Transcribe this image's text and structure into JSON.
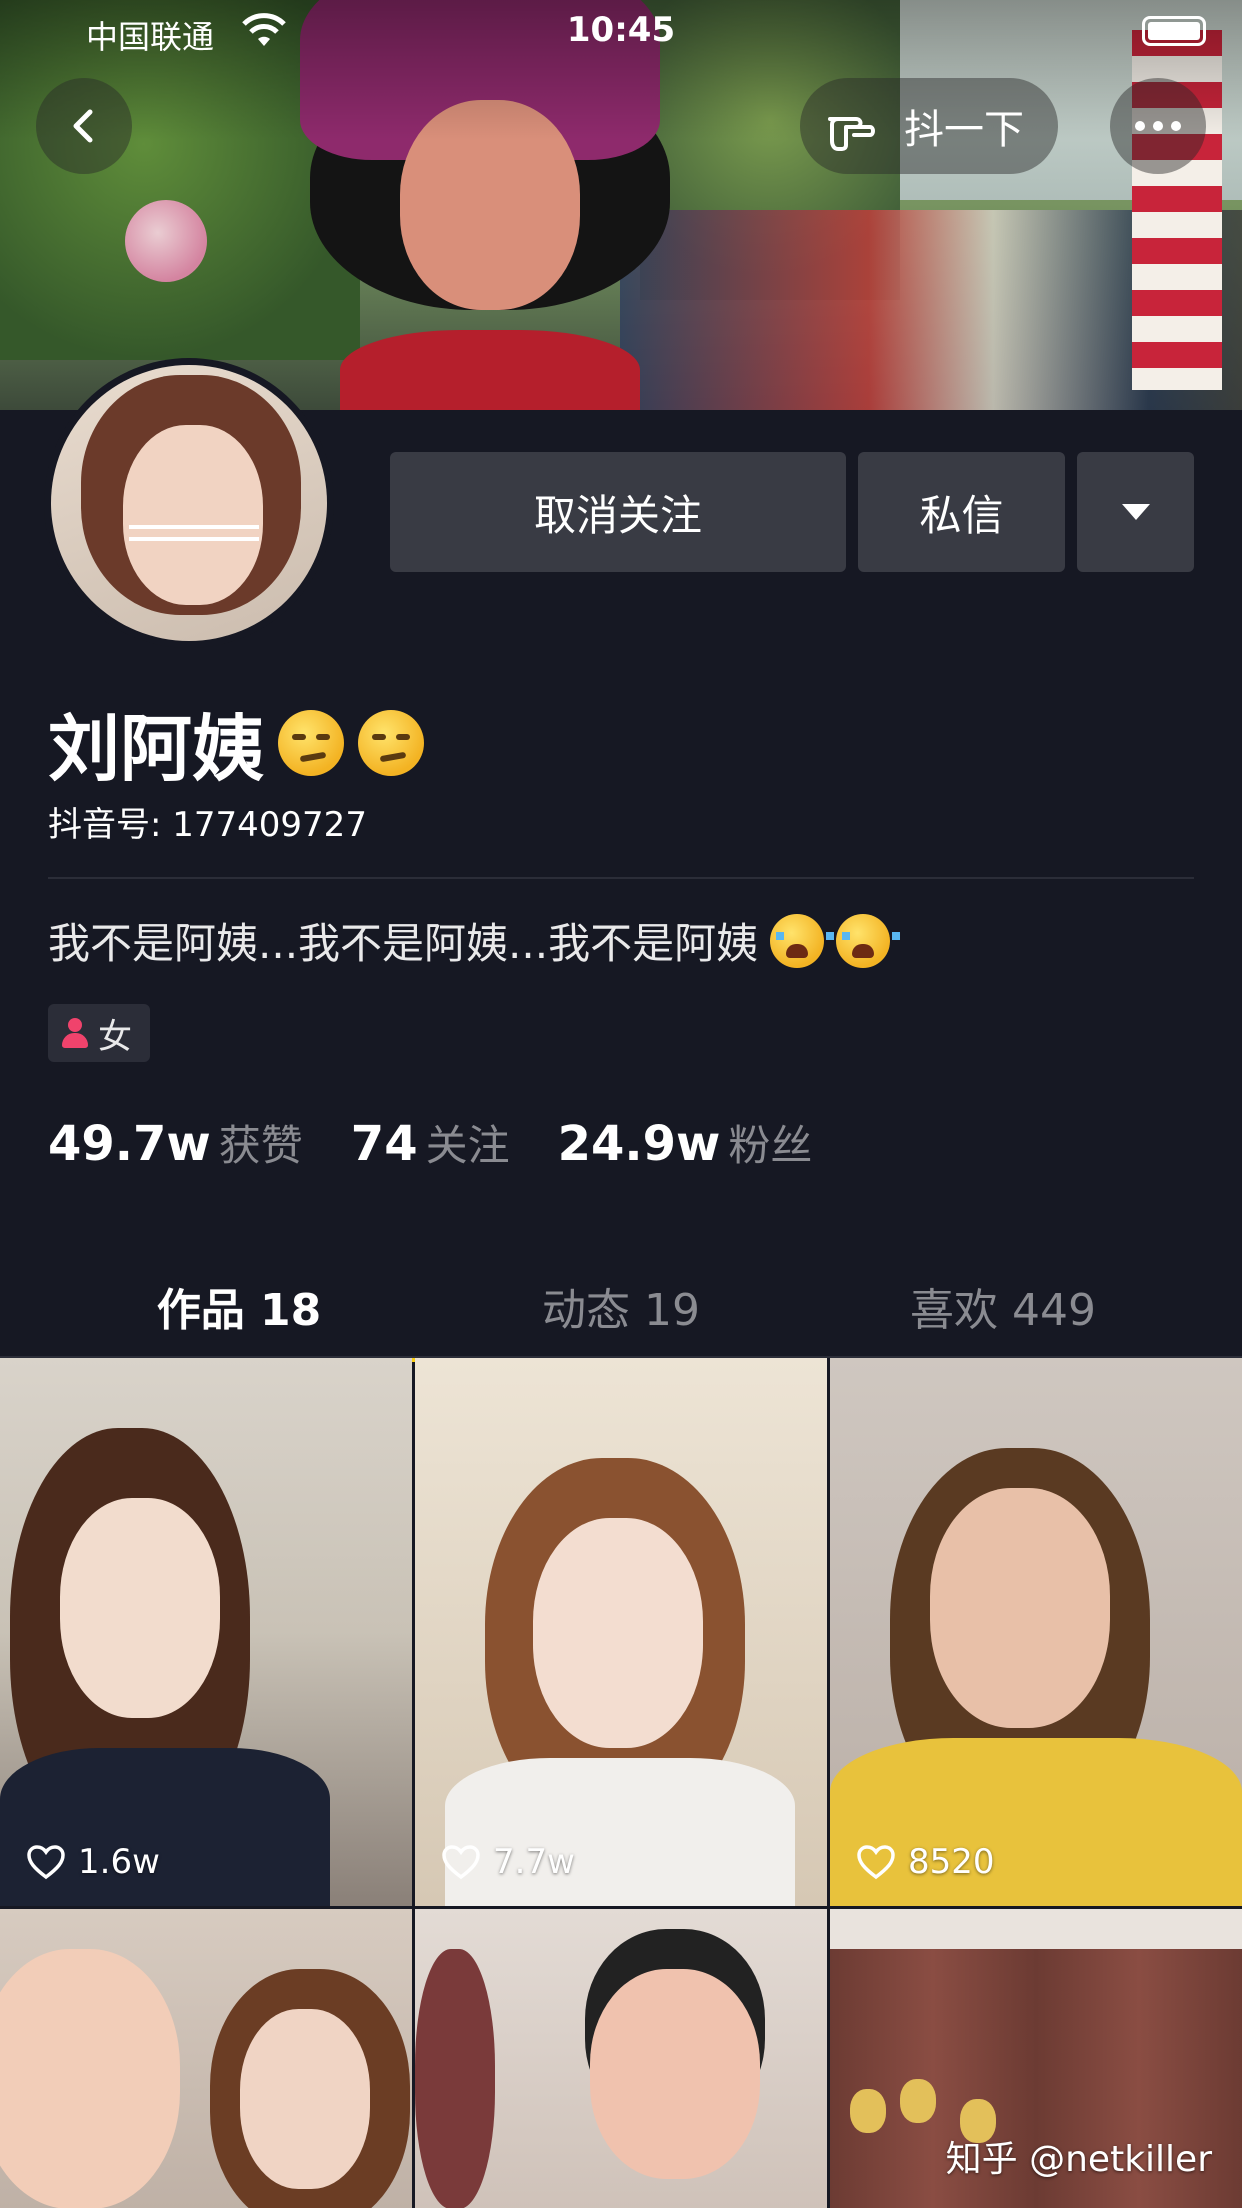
{
  "status_bar": {
    "carrier": "中国联通",
    "time": "10:45"
  },
  "top_controls": {
    "doudou_label": "抖一下"
  },
  "profile": {
    "name": "刘阿姨",
    "douyin_id": "抖音号: 177409727",
    "bio": "我不是阿姨...我不是阿姨...我不是阿姨",
    "gender": "女",
    "stats": [
      {
        "value": "49.7w",
        "label": "获赞"
      },
      {
        "value": "74",
        "label": "关注"
      },
      {
        "value": "24.9w",
        "label": "粉丝"
      }
    ]
  },
  "actions": {
    "unfollow_label": "取消关注",
    "message_label": "私信"
  },
  "tabs": [
    {
      "label": "作品 18",
      "active": true
    },
    {
      "label": "动态 19",
      "active": false
    },
    {
      "label": "喜欢 449",
      "active": false
    }
  ],
  "videos": [
    {
      "likes": "1.6w"
    },
    {
      "likes": "7.7w"
    },
    {
      "likes": "8520"
    },
    {
      "likes": ""
    },
    {
      "likes": ""
    },
    {
      "likes": ""
    }
  ],
  "watermark": "知乎 @netkiller",
  "colors": {
    "background": "#161823",
    "button": "#393b44",
    "tab_indicator": "#face15",
    "muted_text": "#8a8b91",
    "gender_icon": "#f0436c"
  },
  "icons": [
    "back-arrow-icon",
    "wifi-icon",
    "battery-icon",
    "pointing-hand-icon",
    "more-dots-icon",
    "dropdown-triangle-icon",
    "female-icon",
    "heart-icon",
    "smirk-emoji-icon",
    "crying-emoji-icon"
  ]
}
